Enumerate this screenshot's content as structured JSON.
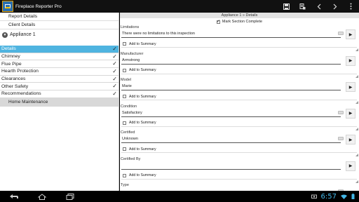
{
  "app": {
    "title": "Fireplace Reporter Pro",
    "accent": "#4fb4e0",
    "icon": "fireplace-app-icon"
  },
  "actionbar": {
    "icons": [
      "save-icon",
      "report-icon",
      "back-arrow-icon",
      "forward-arrow-icon",
      "overflow-menu-icon"
    ]
  },
  "left": {
    "report_details": "Report Details",
    "client_details": "Client Details",
    "appliance_label": "Appliance 1",
    "sections": [
      {
        "label": "Details",
        "checked": "✓"
      },
      {
        "label": "Chimney",
        "checked": "✓"
      },
      {
        "label": "Flue Pipe",
        "checked": "✓"
      },
      {
        "label": "Hearth Protection",
        "checked": "✓"
      },
      {
        "label": "Clearances",
        "checked": "✓"
      },
      {
        "label": "Other Safety",
        "checked": "✓"
      },
      {
        "label": "Recommendations",
        "checked": "✓"
      }
    ],
    "subsection": "Home Maintenance"
  },
  "right": {
    "breadcrumb": "Appliance 1 » Details",
    "mark_complete": "Mark Section Complete",
    "add_to_summary": "Add to Summary",
    "fields": [
      {
        "label": "Limitations",
        "value": "There were no limitations to this inspection"
      },
      {
        "label": "Manufacturer",
        "value": "Armstrong"
      },
      {
        "label": "Model",
        "value": "Marie"
      },
      {
        "label": "Condition",
        "value": "Satisfactory"
      },
      {
        "label": "Certified",
        "value": "Unknown"
      },
      {
        "label": "Certified By",
        "value": ""
      },
      {
        "label": "Type",
        "value": ""
      }
    ]
  },
  "system": {
    "clock": "6:57",
    "icons": [
      "back-icon",
      "home-icon",
      "recent-apps-icon",
      "camera-icon",
      "wifi-icon",
      "battery-icon"
    ]
  }
}
